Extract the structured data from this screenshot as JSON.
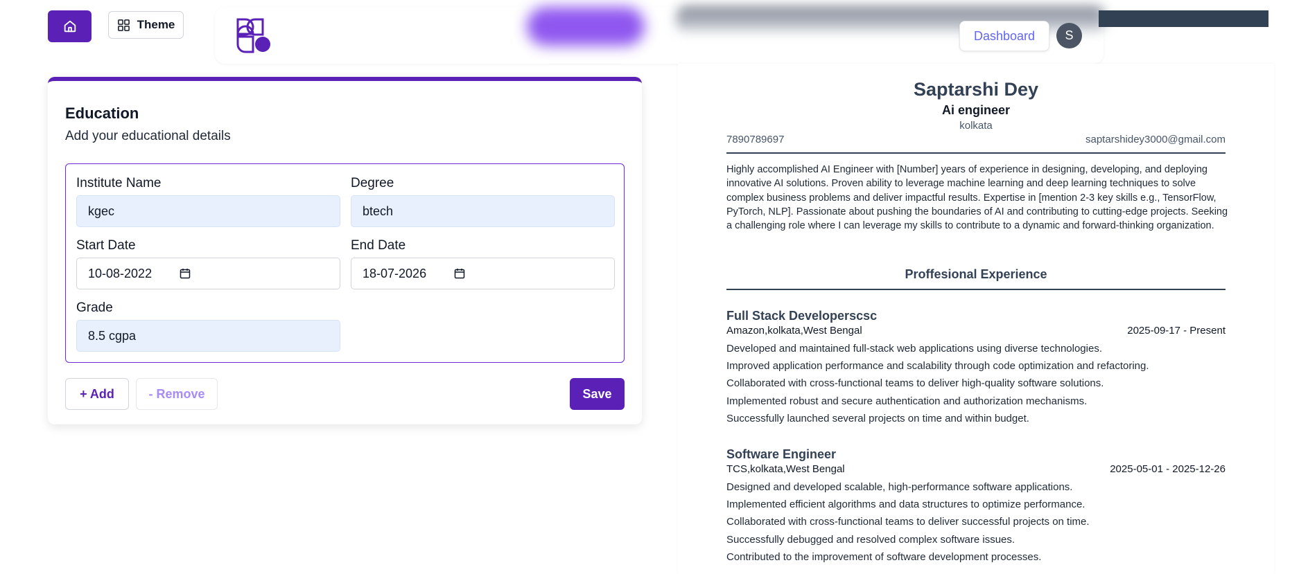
{
  "topbar": {
    "home_icon": "home-icon",
    "theme_label": "Theme",
    "theme_icon": "grid-icon",
    "dashboard_label": "Dashboard",
    "avatar_initial": "S"
  },
  "education": {
    "title": "Education",
    "subtitle": "Add your educational details",
    "fields": {
      "institute_label": "Institute Name",
      "institute_value": "kgec",
      "degree_label": "Degree",
      "degree_value": "btech",
      "start_label": "Start Date",
      "start_value": "10-08-2022",
      "end_label": "End Date",
      "end_value": "18-07-2026",
      "grade_label": "Grade",
      "grade_value": "8.5 cgpa"
    },
    "add_label": "+ Add",
    "remove_label": "- Remove",
    "save_label": "Save"
  },
  "resume": {
    "name": "Saptarshi Dey",
    "role": "Ai engineer",
    "location": "kolkata",
    "phone": "7890789697",
    "email": "saptarshidey3000@gmail.com",
    "summary": "Highly accomplished AI Engineer with [Number] years of experience in designing, developing, and deploying innovative AI solutions. Proven ability to leverage machine learning and deep learning techniques to solve complex business problems and deliver impactful results. Expertise in [mention 2-3 key skills e.g., TensorFlow, PyTorch, NLP]. Passionate about pushing the boundaries of AI and contributing to cutting-edge projects. Seeking a challenging role where I can leverage my skills to contribute to a dynamic and forward-thinking organization.",
    "experience_heading": "Proffesional Experience",
    "jobs": [
      {
        "title": "Full Stack Developerscsc",
        "company": "Amazon,kolkata,West Bengal",
        "dates": "2025-09-17 - Present",
        "bullets": [
          "Developed and maintained full-stack web applications using diverse technologies.",
          "Improved application performance and scalability through code optimization and refactoring.",
          "Collaborated with cross-functional teams to deliver high-quality software solutions.",
          "Implemented robust and secure authentication and authorization mechanisms.",
          "Successfully launched several projects on time and within budget."
        ]
      },
      {
        "title": "Software Engineer",
        "company": "TCS,kolkata,West Bengal",
        "dates": "2025-05-01 - 2025-12-26",
        "bullets": [
          "Designed and developed scalable, high-performance software applications.",
          "Implemented efficient algorithms and data structures to optimize performance.",
          "Collaborated with cross-functional teams to deliver successful projects on time.",
          "Successfully debugged and resolved complex software issues.",
          "Contributed to the improvement of software development processes."
        ]
      }
    ]
  }
}
